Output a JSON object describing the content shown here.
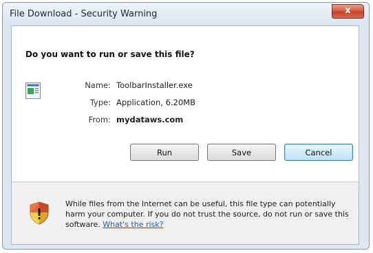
{
  "window": {
    "title": "File Download - Security Warning",
    "close_label": "x"
  },
  "dialog": {
    "question": "Do you want to run or save this file?",
    "file": {
      "name_label": "Name:",
      "name_value": "ToolbarInstaller.exe",
      "type_label": "Type:",
      "type_value": "Application, 6.20MB",
      "from_label": "From:",
      "from_value": "mydataws.com"
    },
    "buttons": {
      "run": "Run",
      "save": "Save",
      "cancel": "Cancel"
    }
  },
  "warning": {
    "text": "While files from the Internet can be useful, this file type can potentially harm your computer. If you do not trust the source, do not run or save this software.",
    "link": "What's the risk?"
  },
  "icons": {
    "file": "application-file-icon",
    "shield": "security-shield-icon",
    "close": "close-icon"
  },
  "colors": {
    "link": "#1a5fb4",
    "close_button": "#c94a33"
  }
}
